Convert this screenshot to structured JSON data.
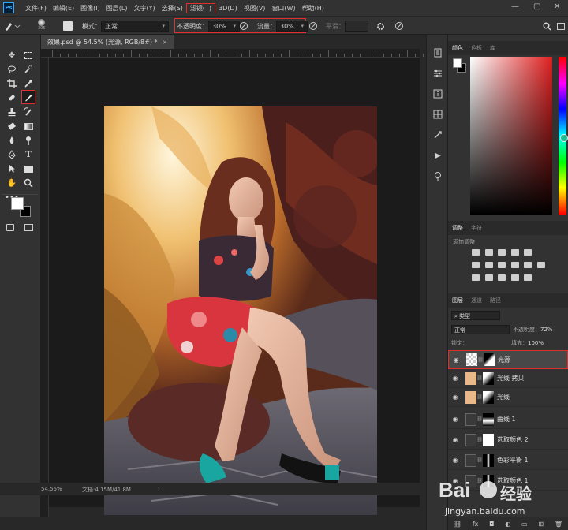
{
  "menubar": {
    "app_icon": "Ps",
    "items": [
      "文件(F)",
      "编辑(E)",
      "图像(I)",
      "图层(L)",
      "文字(Y)",
      "选择(S)",
      "滤镜(T)",
      "3D(D)",
      "视图(V)",
      "窗口(W)",
      "帮助(H)"
    ],
    "highlighted_item": "滤镜(T)"
  },
  "options": {
    "brush_size": "305",
    "mode_label": "模式：",
    "mode_value": "正常",
    "opacity_label": "不透明度：",
    "opacity_value": "30%",
    "flow_label": "流量：",
    "flow_value": "30%",
    "smoothing_label": "平滑："
  },
  "document": {
    "tab_title": "效果.psd @ 54.5% (光源, RGB/8#) *",
    "zoom": "54.55%",
    "doc_info": "文档:4.15M/41.8M"
  },
  "panels": {
    "color_tabs": [
      "颜色",
      "色板",
      "库"
    ],
    "adjust_tabs": [
      "调整",
      "字符"
    ],
    "adjust_add": "添加调整",
    "layer_tabs": [
      "图层",
      "通道",
      "路径"
    ],
    "kind_label": "类型",
    "blend_mode": "正常",
    "opacity_label": "不透明度：",
    "opacity_value": "72%",
    "lock_label": "锁定：",
    "fill_label": "填充：",
    "fill_value": "100%",
    "layers": [
      "光源",
      "光线 拷贝",
      "光线",
      "曲线 1",
      "选取颜色 2",
      "色彩平衡 1",
      "选取颜色 1"
    ],
    "selected_layer": "光源"
  },
  "watermark": {
    "brand": "Bai",
    "brand2": "经验",
    "url": "jingyan.baidu.com"
  },
  "colors": {
    "highlight": "#e0302c",
    "panel_bg": "#323232",
    "canvas_bg": "#282828"
  }
}
